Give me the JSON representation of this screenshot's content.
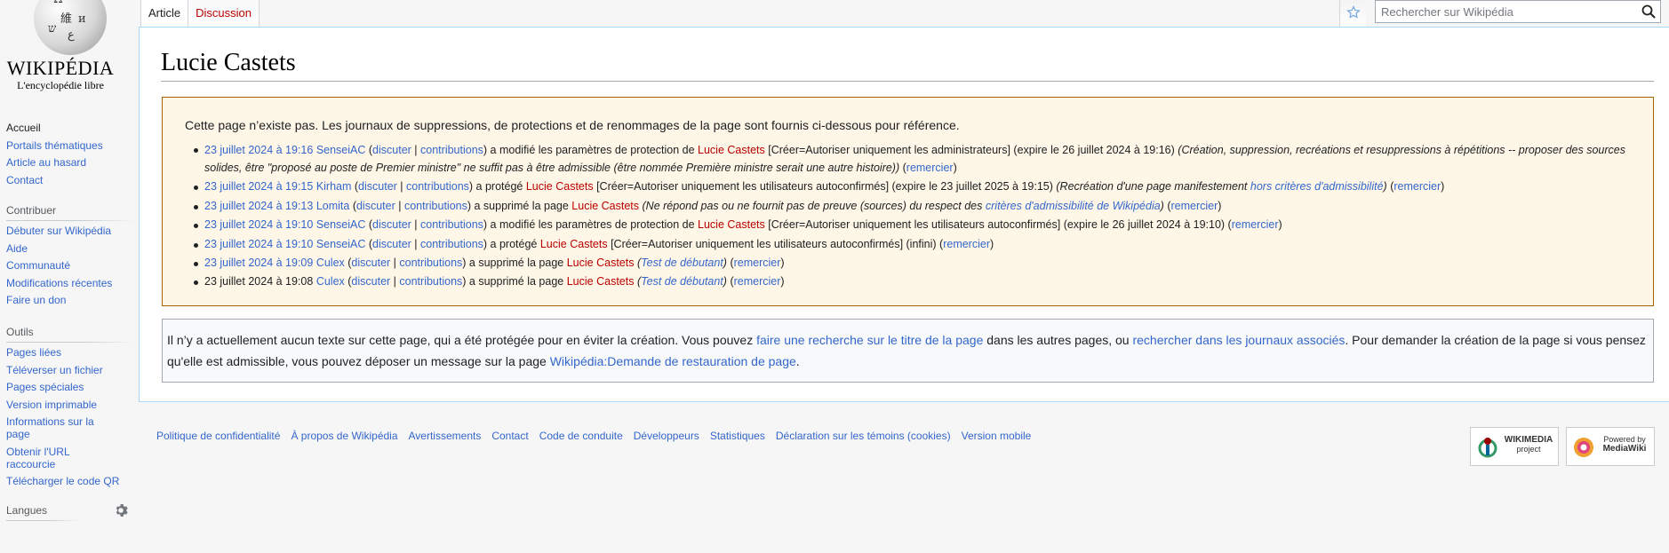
{
  "logo": {
    "wordmark": "Wikipédia",
    "tagline": "L'encyclopédie libre"
  },
  "sidebar": {
    "navigation": [
      "Accueil",
      "Portails thématiques",
      "Article au hasard",
      "Contact"
    ],
    "contribute": {
      "heading": "Contribuer",
      "items": [
        "Débuter sur Wikipédia",
        "Aide",
        "Communauté",
        "Modifications récentes",
        "Faire un don"
      ]
    },
    "tools": {
      "heading": "Outils",
      "items": [
        "Pages liées",
        "Téléverser un fichier",
        "Pages spéciales",
        "Version imprimable",
        "Informations sur la page",
        "Obtenir l'URL raccourcie",
        "Télécharger le code QR"
      ]
    },
    "languages": {
      "heading": "Langues"
    }
  },
  "tabs": {
    "article": "Article",
    "discussion": "Discussion"
  },
  "search": {
    "placeholder": "Rechercher sur Wikipédia"
  },
  "page": {
    "title": "Lucie Castets",
    "log_intro": "Cette page n’existe pas. Les journaux de suppressions, de protections et de renommages de la page sont fournis ci-dessous pour référence.",
    "log_entries": [
      {
        "date": "23 juillet 2024 à 19:16",
        "user": "SenseiAC",
        "talk": "discuter",
        "contribs": "contributions",
        "action": "a modifié les paramètres de protection de",
        "page": "Lucie Castets",
        "details": "[Créer=Autoriser uniquement les administrateurs] (expire le 26 juillet 2024 à 19:16)",
        "comment": "(Création, suppression, recréations et resuppressions à répétitions -- proposer des sources solides, être \"proposé au poste de Premier ministre\" ne suffit pas à être admissible (être nommée Première ministre serait une autre histoire))",
        "thank": "remercier"
      },
      {
        "date": "23 juillet 2024 à 19:15",
        "user": "Kirham",
        "talk": "discuter",
        "contribs": "contributions",
        "action": "a protégé",
        "page": "Lucie Castets",
        "details": "[Créer=Autoriser uniquement les utilisateurs autoconfirmés] (expire le 23 juillet 2025 à 19:15)",
        "comment_pre": "(Recréation d'une page manifestement",
        "comment_link": "hors critères d'admissibilité",
        "comment_post": ")",
        "thank": "remercier"
      },
      {
        "date": "23 juillet 2024 à 19:13",
        "user": "Lomita",
        "talk": "discuter",
        "contribs": "contributions",
        "action": "a supprimé la page",
        "page": "Lucie Castets",
        "comment_pre": "(Ne répond pas ou ne fournit pas de preuve (sources) du respect des",
        "comment_link": "critères d'admissibilité de Wikipédia",
        "comment_post": ")",
        "thank": "remercier"
      },
      {
        "date": "23 juillet 2024 à 19:10",
        "user": "SenseiAC",
        "talk": "discuter",
        "contribs": "contributions",
        "action": "a modifié les paramètres de protection de",
        "page": "Lucie Castets",
        "details": "[Créer=Autoriser uniquement les utilisateurs autoconfirmés] (expire le 26 juillet 2024 à 19:10)",
        "thank": "remercier"
      },
      {
        "date": "23 juillet 2024 à 19:10",
        "user": "SenseiAC",
        "talk": "discuter",
        "contribs": "contributions",
        "action": "a protégé",
        "page": "Lucie Castets",
        "details": "[Créer=Autoriser uniquement les utilisateurs autoconfirmés] (infini)",
        "thank": "remercier"
      },
      {
        "date": "23 juillet 2024 à 19:09",
        "user": "Culex",
        "talk": "discuter",
        "contribs": "contributions",
        "action": "a supprimé la page",
        "page": "Lucie Castets",
        "comment_pre": "(",
        "comment_link": "Test de débutant",
        "comment_post": ")",
        "thank": "remercier"
      },
      {
        "date": "23 juillet 2024 à 19:08",
        "user": "Culex",
        "talk": "discuter",
        "contribs": "contributions",
        "action": "a supprimé la page",
        "page": "Lucie Castets",
        "comment_pre": "(",
        "comment_link": "Test de débutant",
        "comment_post": ")",
        "thank": "remercier"
      }
    ],
    "notice": {
      "text1": "Il n’y a actuellement aucun texte sur cette page, qui a été protégée pour en éviter la création. Vous pouvez",
      "link1": "faire une recherche sur le titre de la page",
      "text2": "dans les autres pages, ou",
      "link2": "rechercher dans les journaux associés",
      "text3": ". Pour demander la création de la page si vous pensez qu'elle est admissible, vous pouvez déposer un message sur la page",
      "link3": "Wikipédia:Demande de restauration de page",
      "text4": "."
    }
  },
  "footer": {
    "links": [
      "Politique de confidentialité",
      "À propos de Wikipédia",
      "Avertissements",
      "Contact",
      "Code de conduite",
      "Développeurs",
      "Statistiques",
      "Déclaration sur les témoins (cookies)",
      "Version mobile"
    ],
    "badge_wikimedia": {
      "line1": "WIKIMEDIA",
      "line2": "project"
    },
    "badge_mediawiki": {
      "line1": "Powered by",
      "line2": "MediaWiki"
    }
  },
  "colors": {
    "link": "#3366cc",
    "redlink": "#ba0000",
    "log_box_bg": "#fef6e7",
    "log_box_border": "#a66200"
  }
}
